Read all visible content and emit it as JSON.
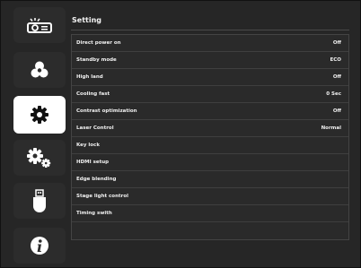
{
  "header": {
    "title": "Setting"
  },
  "sidebar": {
    "items": [
      {
        "icon": "projector-icon",
        "active": false
      },
      {
        "icon": "color-wheel-icon",
        "active": false
      },
      {
        "icon": "gear-icon",
        "active": true
      },
      {
        "icon": "advanced-gears-icon",
        "active": false
      },
      {
        "icon": "usb-icon",
        "active": false
      },
      {
        "icon": "info-icon",
        "active": false
      }
    ]
  },
  "settings": {
    "rows": [
      {
        "label": "Direct power on",
        "value": "Off"
      },
      {
        "label": "Standby mode",
        "value": "ECO"
      },
      {
        "label": "High land",
        "value": "Off"
      },
      {
        "label": "Cooling fast",
        "value": "0 Sec"
      },
      {
        "label": "Contrast optimization",
        "value": "Off"
      },
      {
        "label": "Laser Control",
        "value": "Normal"
      },
      {
        "label": "Key lock",
        "value": ""
      },
      {
        "label": "HDMI setup",
        "value": ""
      },
      {
        "label": "Edge blending",
        "value": ""
      },
      {
        "label": "Stage light control",
        "value": ""
      },
      {
        "label": "Timing swith",
        "value": ""
      }
    ]
  },
  "colors": {
    "active_bg": "#ffffff",
    "panel_bg": "#2a2a2a",
    "text": "#f0f0f0"
  }
}
